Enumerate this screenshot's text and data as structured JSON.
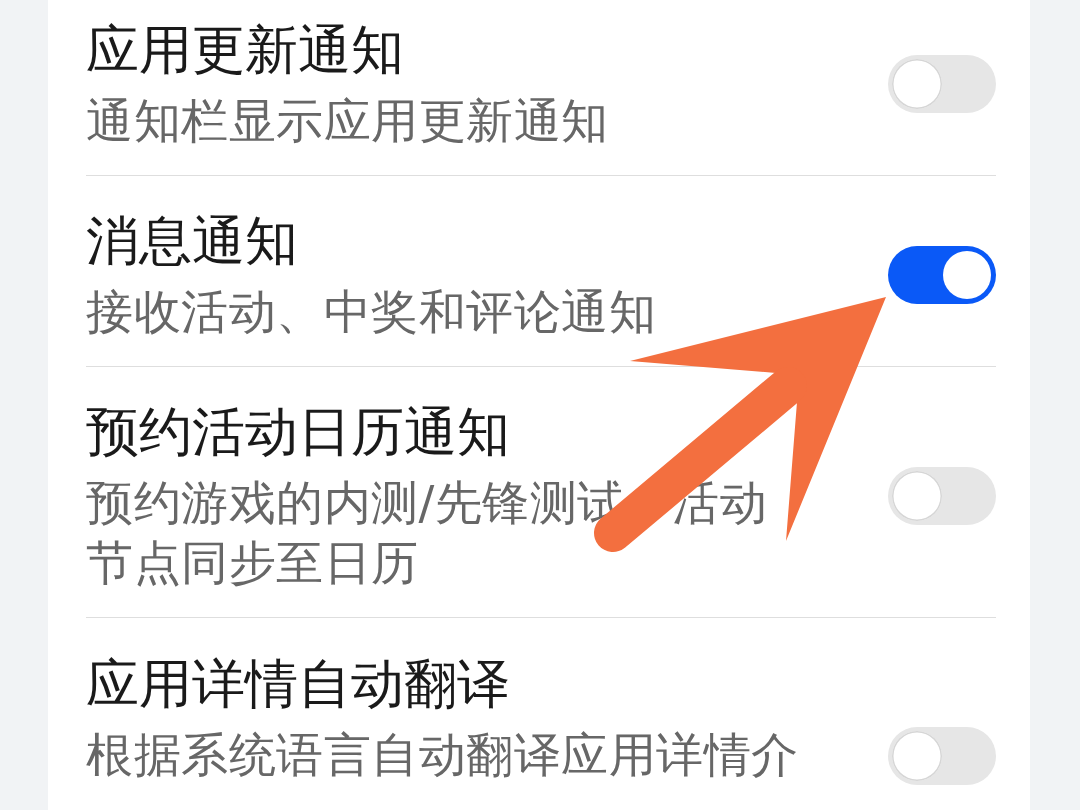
{
  "settings": [
    {
      "title": "应用更新通知",
      "subtitle": [
        [
          "通知栏显示应用更新通知"
        ]
      ],
      "on": false
    },
    {
      "title": "消息通知",
      "subtitle": [
        [
          "接收活动、中奖和评论通知"
        ]
      ],
      "on": true
    },
    {
      "title": "预约活动日历通知",
      "subtitle": [
        [
          "预约游戏的内测/先锋测试",
          "活动"
        ],
        [
          "节点同步至日历"
        ]
      ],
      "on": false
    },
    {
      "title": "应用详情自动翻译",
      "subtitle": [
        [
          "根据系统语言自动翻译应用详情介"
        ]
      ],
      "on": false
    }
  ],
  "annotation": {
    "kind": "arrow"
  }
}
